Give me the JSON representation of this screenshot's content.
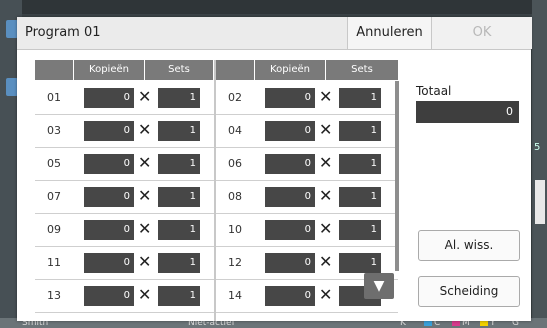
{
  "dialog": {
    "title": "Program 01",
    "cancel_label": "Annuleren",
    "ok_label": "OK"
  },
  "table": {
    "headers": [
      "Kopieën",
      "Sets",
      "Kopieën",
      "Sets"
    ],
    "multiply_symbol": "✕",
    "rows": [
      {
        "left": {
          "num": "01",
          "copies": "0",
          "sets": "1"
        },
        "right": {
          "num": "02",
          "copies": "0",
          "sets": "1"
        }
      },
      {
        "left": {
          "num": "03",
          "copies": "0",
          "sets": "1"
        },
        "right": {
          "num": "04",
          "copies": "0",
          "sets": "1"
        }
      },
      {
        "left": {
          "num": "05",
          "copies": "0",
          "sets": "1"
        },
        "right": {
          "num": "06",
          "copies": "0",
          "sets": "1"
        }
      },
      {
        "left": {
          "num": "07",
          "copies": "0",
          "sets": "1"
        },
        "right": {
          "num": "08",
          "copies": "0",
          "sets": "1"
        }
      },
      {
        "left": {
          "num": "09",
          "copies": "0",
          "sets": "1"
        },
        "right": {
          "num": "10",
          "copies": "0",
          "sets": "1"
        }
      },
      {
        "left": {
          "num": "11",
          "copies": "0",
          "sets": "1"
        },
        "right": {
          "num": "12",
          "copies": "0",
          "sets": "1"
        }
      },
      {
        "left": {
          "num": "13",
          "copies": "0",
          "sets": "1"
        },
        "right": {
          "num": "14",
          "copies": "0",
          "sets": "1"
        }
      }
    ]
  },
  "total": {
    "label": "Totaal",
    "value": "0"
  },
  "buttons": {
    "clear_all": "Al. wiss.",
    "separation": "Scheiding"
  },
  "scroll_down_glyph": "▼",
  "background": {
    "user_name": "Smith",
    "status": "Niet-actief",
    "side_number": "5",
    "color_labels": [
      "K",
      "C",
      "M",
      "Y",
      "G"
    ]
  }
}
